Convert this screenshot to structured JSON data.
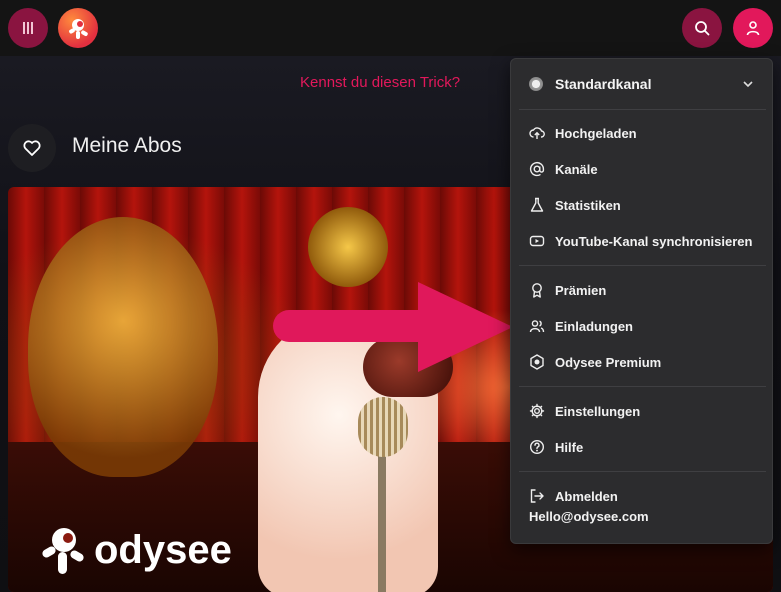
{
  "header": {
    "menu_icon": "menu-bars-icon",
    "logo_icon": "odysee-logo-icon",
    "search_icon": "search-icon",
    "user_icon": "user-icon"
  },
  "main": {
    "trick_link": "Kennst du diesen Trick?",
    "section_title": "Meine Abos",
    "section_icon": "heart-icon",
    "hero_brand": "odysee"
  },
  "dropdown": {
    "channel_name": "Standardkanal",
    "group1": [
      {
        "label": "Hochgeladen",
        "icon": "cloud-upload-icon"
      },
      {
        "label": "Kanäle",
        "icon": "at-sign-icon"
      },
      {
        "label": "Statistiken",
        "icon": "flask-icon"
      },
      {
        "label": "YouTube-Kanal synchronisieren",
        "icon": "youtube-icon"
      }
    ],
    "group2": [
      {
        "label": "Prämien",
        "icon": "award-icon"
      },
      {
        "label": "Einladungen",
        "icon": "users-icon"
      },
      {
        "label": "Odysee Premium",
        "icon": "premium-badge-icon"
      }
    ],
    "group3": [
      {
        "label": "Einstellungen",
        "icon": "gear-icon"
      },
      {
        "label": "Hilfe",
        "icon": "help-circle-icon"
      }
    ],
    "signout_label": "Abmelden",
    "signout_email": "Hello@odysee.com"
  },
  "colors": {
    "accent": "#e2185b",
    "accent_dark": "#8a1440",
    "menu_bg": "#2c2c2e"
  }
}
